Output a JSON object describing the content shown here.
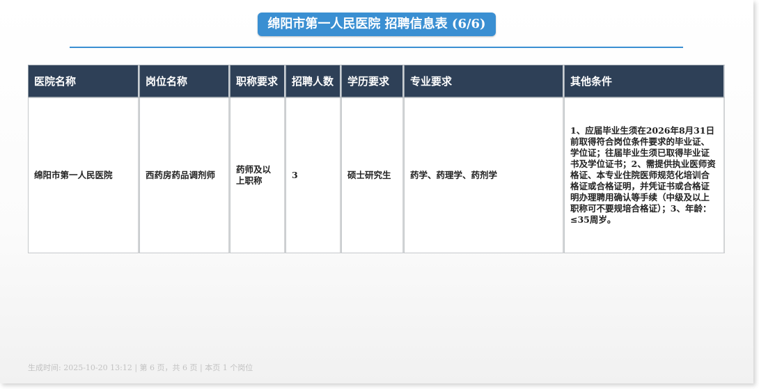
{
  "title": "绵阳市第一人民医院 招聘信息表 (6/6)",
  "table": {
    "headers": [
      "医院名称",
      "岗位名称",
      "职称要求",
      "招聘人数",
      "学历要求",
      "专业要求",
      "其他条件"
    ],
    "rows": [
      {
        "hospital": "绵阳市第一人民医院",
        "position": "西药房药品调剂师",
        "title_req": "药师及以上职称",
        "count": "3",
        "education": "硕士研究生",
        "major": "药学、药理学、药剂学",
        "other": "1、应届毕业生须在2026年8月31日前取得符合岗位条件要求的毕业证、学位证；往届毕业生须已取得毕业证书及学位证书；2、需提供执业医师资格证、本专业住院医师规范化培训合格证或合格证明，并凭证书或合格证明办理聘用确认等手续（中级及以上职称可不要规培合格证）；3、年龄：≤35周岁。"
      }
    ]
  },
  "footer": "生成时间: 2025-10-20 13:12 | 第 6 页，共 6 页 | 本页 1 个岗位"
}
